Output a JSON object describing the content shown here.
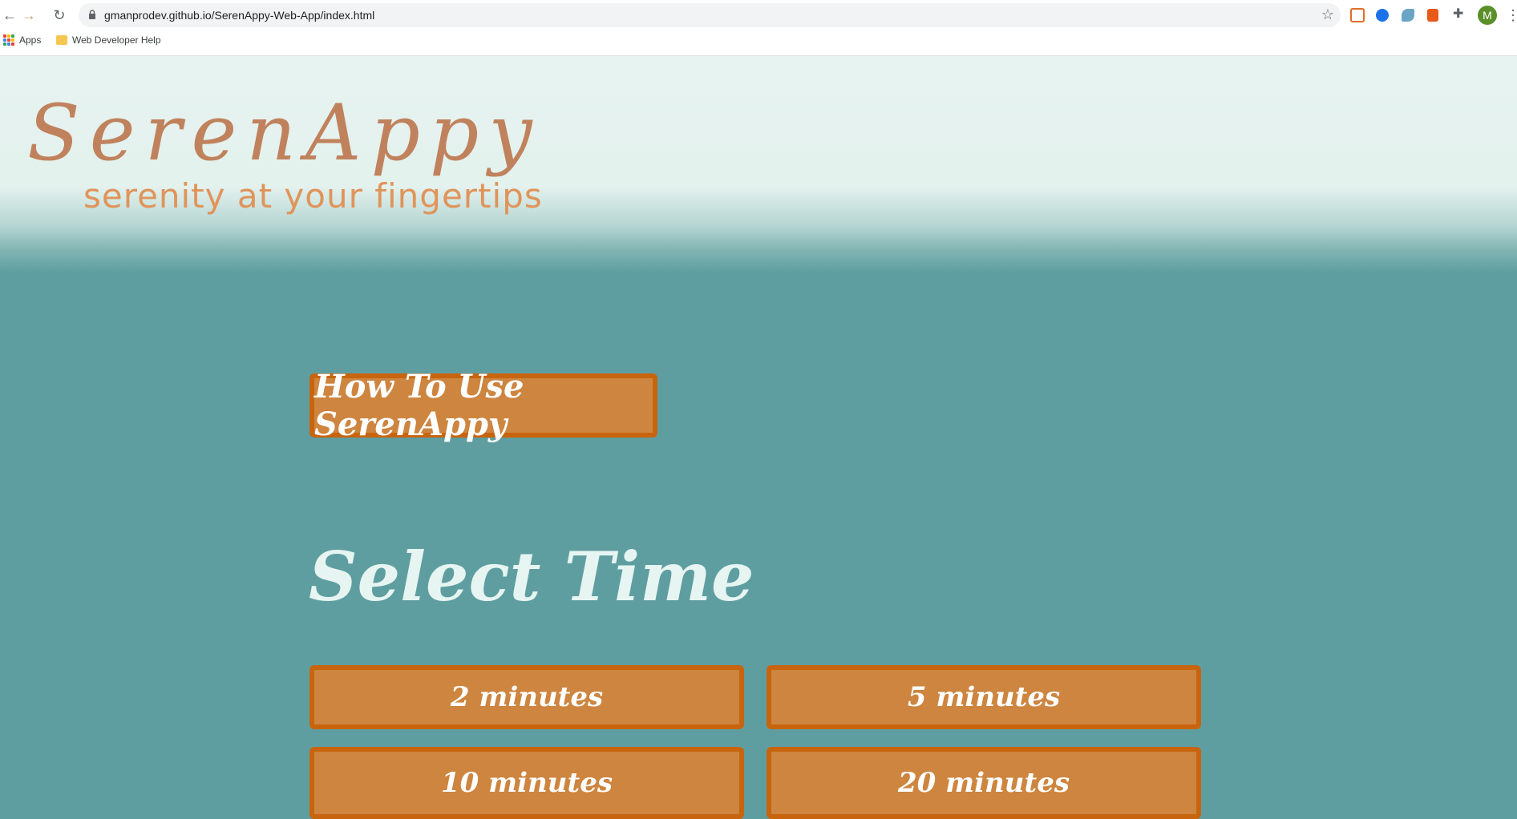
{
  "browser": {
    "url": "gmanprodev.github.io/SerenAppy-Web-App/index.html",
    "profile_initial": "M",
    "bookmarks": [
      {
        "label": "Apps",
        "icon": "apps-grid-icon"
      },
      {
        "label": "Web Developer Help",
        "icon": "folder-icon"
      }
    ]
  },
  "header": {
    "logo": "SerenAppy",
    "tagline": "serenity at your fingertips"
  },
  "main": {
    "how_to_label": "How To Use SerenAppy",
    "section_title": "Select Time",
    "time_options": [
      {
        "label": "2 minutes"
      },
      {
        "label": "5 minutes"
      },
      {
        "label": "10 minutes"
      },
      {
        "label": "20 minutes"
      }
    ]
  },
  "colors": {
    "page_bg": "#5f9ea0",
    "header_bg": "#e6f3f0",
    "button_fill": "#cd853f",
    "button_border": "#c8640e",
    "logo": "#c0825d",
    "tagline": "#e0945a"
  }
}
